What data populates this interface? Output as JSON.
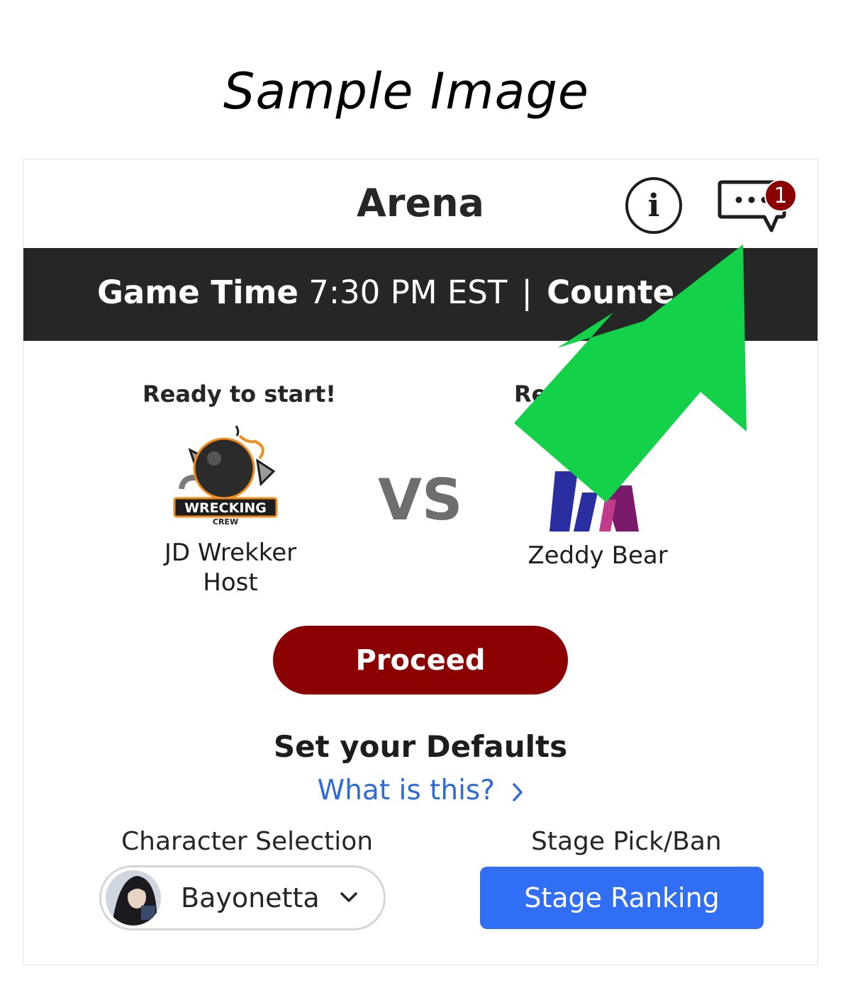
{
  "caption": "Sample Image",
  "header": {
    "title": "Arena",
    "info_icon": "i",
    "chat_badge_count": "1"
  },
  "banner": {
    "game_time_label": "Game Time",
    "game_time_value": "7:30 PM EST",
    "separator": "|",
    "countdown_label": "Counte"
  },
  "match": {
    "left_status": "Ready to start!",
    "right_status": "Re",
    "vs_text": "VS",
    "left_team": {
      "name": "JD Wrekker",
      "role": "Host",
      "logo_text": "WRECKING",
      "logo_subtext": "CREW"
    },
    "right_team": {
      "name": "Zeddy Bear"
    }
  },
  "actions": {
    "proceed_label": "Proceed"
  },
  "defaults": {
    "title": "Set your Defaults",
    "help_link": "What is this?",
    "character_label": "Character Selection",
    "character_value": "Bayonetta",
    "stage_label": "Stage Pick/Ban",
    "stage_button": "Stage Ranking"
  },
  "colors": {
    "banner_bg": "#262626",
    "proceed_bg": "#8b0000",
    "badge_bg": "#8b0000",
    "link": "#2f6bd8",
    "stage_button_bg": "#2f6ef5",
    "arrow": "#14d14a"
  }
}
